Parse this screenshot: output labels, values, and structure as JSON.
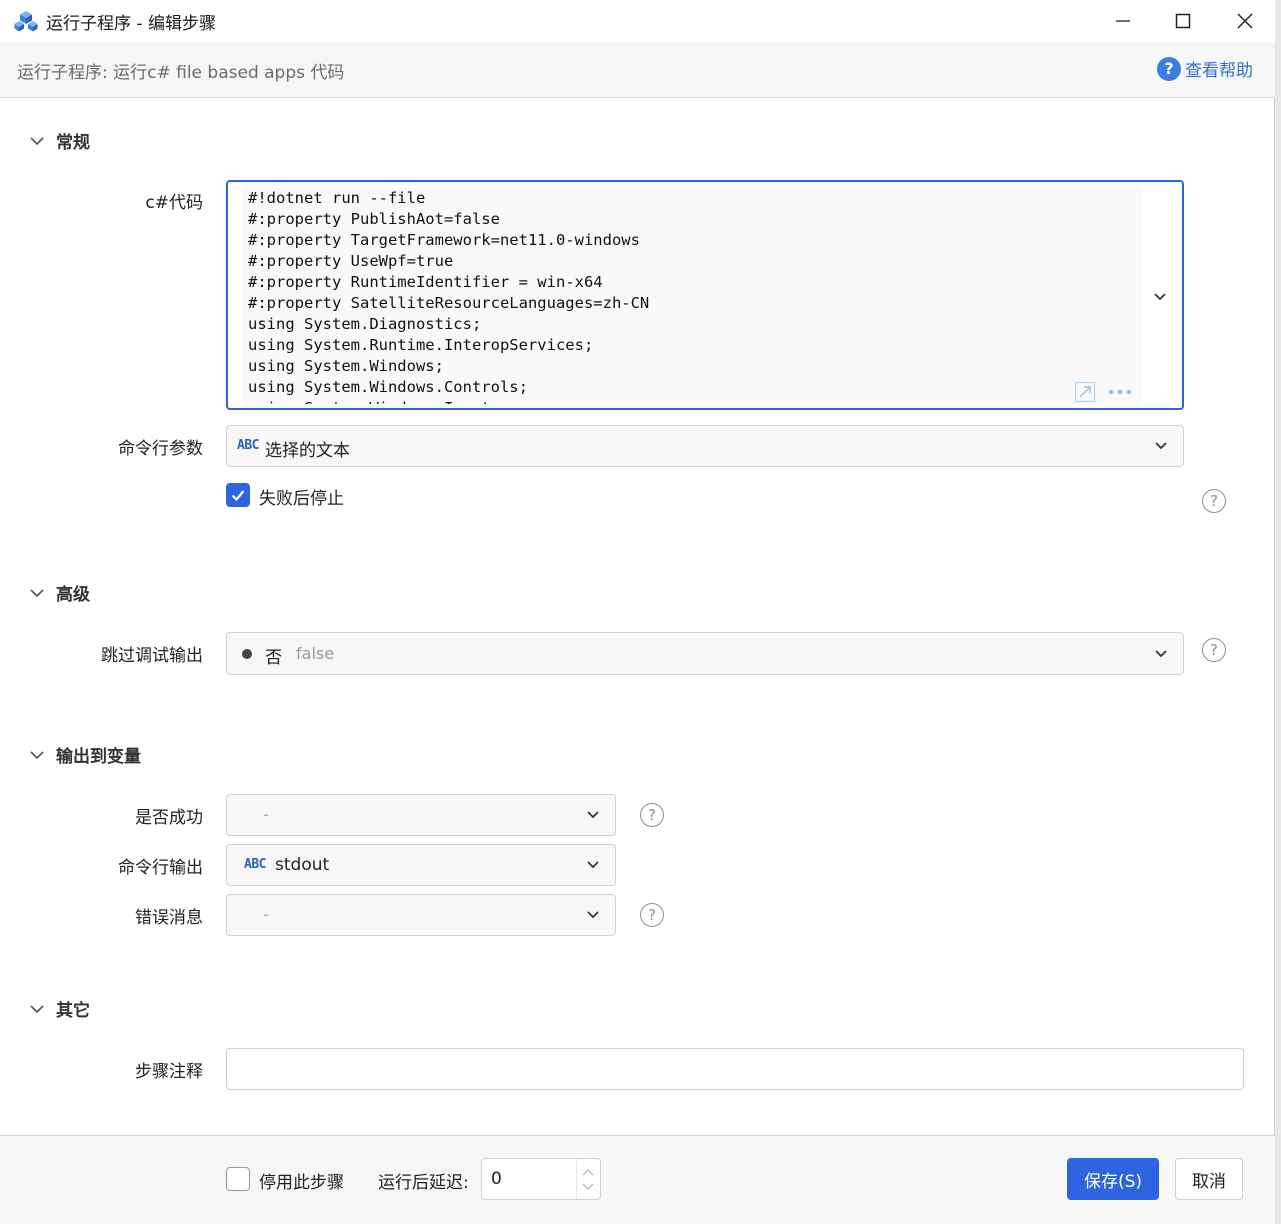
{
  "window": {
    "title": "运行子程序  -  编辑步骤",
    "subtitle": "运行子程序: 运行c# file based apps 代码",
    "help_label": "查看帮助",
    "help_icon": "?"
  },
  "sections": {
    "general": "常规",
    "advanced": "高级",
    "output": "输出到变量",
    "other": "其它"
  },
  "general": {
    "code_label": "c#代码",
    "code_lines": [
      "#!dotnet run --file",
      "#:property PublishAot=false",
      "#:property TargetFramework=net11.0-windows",
      "#:property UseWpf=true",
      "#:property RuntimeIdentifier = win-x64",
      "#:property SatelliteResourceLanguages=zh-CN",
      "using System.Diagnostics;",
      "using System.Runtime.InteropServices;",
      "using System.Windows;",
      "using System.Windows.Controls;",
      "using System.Windows.Input;"
    ],
    "args_label": "命令行参数",
    "args_type": "ABC",
    "args_value": "选择的文本",
    "stop_on_fail_label": "失败后停止",
    "stop_on_fail_checked": true
  },
  "advanced": {
    "skip_debug_label": "跳过调试输出",
    "skip_debug_value": "否",
    "skip_debug_hint": "false"
  },
  "output": {
    "success_label": "是否成功",
    "success_value": "-",
    "stdout_label": "命令行输出",
    "stdout_type": "ABC",
    "stdout_value": "stdout",
    "error_label": "错误消息",
    "error_value": "-"
  },
  "other": {
    "note_label": "步骤注释",
    "note_value": ""
  },
  "footer": {
    "disable_label": "停用此步骤",
    "disable_checked": false,
    "delay_label": "运行后延迟:",
    "delay_value": "0",
    "save_label": "保存(S)",
    "cancel_label": "取消"
  },
  "colors": {
    "accent": "#2e64e0",
    "help": "#3d7fe0"
  }
}
